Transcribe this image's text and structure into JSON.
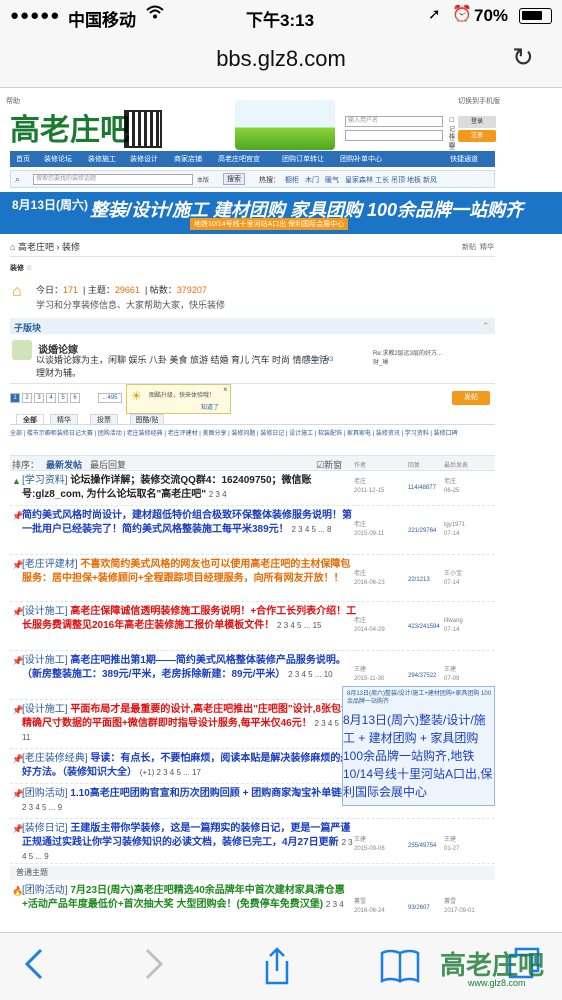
{
  "status": {
    "signal": "●●●●●",
    "carrier": "中国移动",
    "time": "下午3:13",
    "battery": "70%"
  },
  "browser": {
    "url": "bbs.glz8.com"
  },
  "site": {
    "help": "帮助",
    "switch_mobile": "切换到手机版",
    "logo": "高老庄吧",
    "login": {
      "username_placeholder": "输入用户名",
      "password_placeholder": "",
      "remember": "记住登录",
      "forgot": "找回密码",
      "login_btn": "登录",
      "register_btn": "注册"
    },
    "nav": [
      "首页",
      "装修论坛",
      "装修施工",
      "装修设计",
      "商家店铺",
      "高老庄吧官宣",
      "团购订单转让",
      "团购补单中心"
    ],
    "quick": "快捷通道",
    "search_placeholder": "搜索您要找的装修话题",
    "search_scope": "本版",
    "search_btn": "搜索",
    "hot_label": "热搜：",
    "hot": [
      "橱柜",
      "木门",
      "暖气",
      "皇家森林",
      "工长",
      "吊顶",
      "地板",
      "新风"
    ]
  },
  "banner": {
    "date": "8月13日(周六)",
    "main": "整装/设计/施工 建材团购 家具团购 100余品牌一站购齐",
    "sub": "地铁10/14号线十里河站A口出 保利国际会展中心"
  },
  "breadcrumb": {
    "text": "高老庄吧 › 装修",
    "new": "新贴",
    "best": "精华"
  },
  "board": {
    "name": "装修",
    "today_label": "今日：",
    "today": "171",
    "topics_label": "主题：",
    "topics": "29661",
    "posts_label": "帖数：",
    "posts": "379207",
    "desc": "学习和分享装修信息、大家帮助大家，快乐装修"
  },
  "subforum": {
    "heading": "子版块",
    "name": "谈婚论嫁",
    "desc": "以谈婚论嫁为主，闲聊 娱乐 八卦 美食 旅游 结婚 育儿 汽车 时尚 情感生活 理财为辅。",
    "counts": "123/2743",
    "last_title": "Re:求教2层远3层的好方...",
    "last_by": "财_琳"
  },
  "pager": [
    "1",
    "2",
    "3",
    "4",
    "5",
    "6",
    "...495"
  ],
  "post_btn": "发帖",
  "tip": {
    "text": "图酷升级，快来体验哦！",
    "ok": "知道了"
  },
  "tabs": [
    "全部",
    "精华",
    "投票",
    "图酷/贴"
  ],
  "cats": "全部 | 楼市示橱柜装修日记大赛 | 团购活动 | 老庄装修经典 | 老庄评建材 | 美图分享 | 装修问题 | 装修日记 | 设计施工 | 软装配饰 | 家具家电 | 装修资讯 | 学习资料 | 装修口碑",
  "sort": {
    "label": "排序：",
    "new": "最新发帖",
    "reply": "最后回复",
    "newwin": "新窗",
    "author": "作者",
    "replies": "回复",
    "last": "最后发表"
  },
  "threads": [
    {
      "cat": "[学习资料]",
      "title": "论坛操作详解；装修交流QQ群4：162409750；微信账号:glz8_com, 为什么论坛取名\"高老庄吧\"",
      "pages": "2 3 4",
      "author": "老庄",
      "date": "2011-12-15",
      "counts": "114/48877",
      "last": "老庄",
      "lastdate": "06-25"
    },
    {
      "cat": "",
      "title": "简约美式风格时尚设计，建材超低特价组合极致环保整体装修服务说明！第一批用户已经装完了！简约美式风格整装施工每平米389元！",
      "pages": "2 3 4 5 ... 8",
      "author": "老庄",
      "date": "2015-09-11",
      "counts": "221/29764",
      "last": "lgy1971",
      "lastdate": "07-14"
    },
    {
      "cat": "[老庄评建材]",
      "title": "不喜欢简约美式风格的网友也可以使用高老庄吧的主材保障包服务：居中担保+装修顾问+全程跟踪项目经理服务，向所有网友开放！！",
      "pages": "",
      "author": "老庄",
      "date": "2016-06-23",
      "counts": "22/1213",
      "last": "王小宝",
      "lastdate": "07-14"
    },
    {
      "cat": "[设计施工]",
      "title": "高老庄保障诚信透明装修施工服务说明！+合作工长列表介绍！工长服务费调整见2016年高老庄装修施工报价单模板文件！",
      "pages": "2 3 4 5 ... 15",
      "author": "老庄",
      "date": "2014-04-29",
      "counts": "423/241594",
      "last": "lifwang",
      "lastdate": "07-14"
    },
    {
      "cat": "[设计施工]",
      "title": "高老庄吧推出第1期——简约美式风格整体装修产品服务说明。（新房整装施工：389元/平米，老房拆除新建：89元/平米）",
      "pages": "2 3 4 5 ... 10",
      "author": "王建",
      "date": "2015-11-30",
      "counts": "294/37522",
      "last": "王建",
      "lastdate": "07-09"
    },
    {
      "cat": "[设计施工]",
      "title": "平面布局才是最重要的设计,高老庄吧推出\"庄吧图\"设计,8张包含精确尺寸数据的平面图+微信群即时指导设计服务,每平米仅46元！",
      "pages": "2 3 4 5 ... 11",
      "author": "",
      "date": "",
      "counts": "",
      "last": "",
      "lastdate": ""
    },
    {
      "cat": "[老庄装修经典]",
      "title": "导读：有点长，不要怕麻烦，阅读本贴是解决装修麻烦的最好方法。（装修知识大全）",
      "pages": "(+1) 2 3 4 5 ... 17",
      "author": "",
      "date": "",
      "counts": "",
      "last": "",
      "lastdate": ""
    },
    {
      "cat": "[团购活动]",
      "title": "1.10高老庄吧团购官宣和历次团购回顾  +  团购商家淘宝补单链接",
      "pages": "2 3 4 5 ... 9",
      "author": "",
      "date": "",
      "counts": "",
      "last": "",
      "lastdate": ""
    },
    {
      "cat": "[装修日记]",
      "title": "王建版主带你学装修，这是一篇翔实的装修日记，更是一篇严谨正规通过实践让你学习装修知识的必读文档，装修已完工，4月27日更新",
      "pages": "2 3 4 5 ... 9",
      "author": "王建",
      "date": "2015-09-06",
      "counts": "255/49754",
      "last": "王建",
      "lastdate": "01-27"
    },
    {
      "cat": "[团购活动]",
      "title": "7月23日(周六)高老庄吧精选40余品牌年中首次建材家具清仓惠+活动产品年度最低价+首次抽大奖 大型团购会！(免费停车免费汉堡)",
      "pages": "2 3 4",
      "author": "薯雪",
      "date": "2016-06-24",
      "counts": "93/2607",
      "last": "薯雪",
      "lastdate": "2017-09-01"
    }
  ],
  "ad": {
    "small": "8月13日(周六)整装/设计/施工+建材团购+家具团购 100余品牌一站购齐",
    "big": "8月13日(周六)整装/设计/施工 + 建材团购 + 家具团购 100余品牌一站购齐,地铁10/14号线十里河站A口出,保利国际会展中心"
  },
  "normal_heading": "普通主题",
  "watermark": {
    "logo": "高老庄吧",
    "url": "www.glz8.com"
  }
}
